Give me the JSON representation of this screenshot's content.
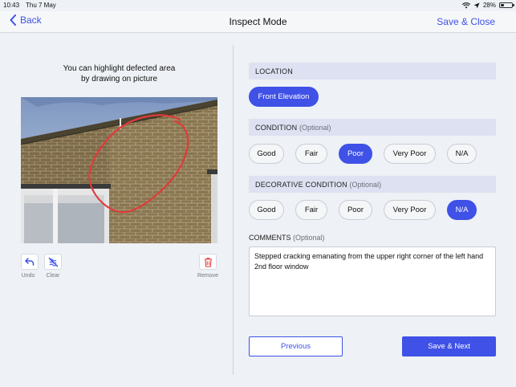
{
  "status_bar": {
    "time": "10:43",
    "date": "Thu 7 May",
    "battery": "28%",
    "battery_level": 0.28
  },
  "nav": {
    "back_label": "Back",
    "title": "Inspect Mode",
    "save_close_label": "Save & Close"
  },
  "editor": {
    "hint_line1": "You can highlight defected area",
    "hint_line2": "by drawing on picture",
    "undo_label": "Undo",
    "clear_label": "Clear",
    "remove_label": "Remove"
  },
  "location": {
    "heading": "LOCATION",
    "options": [
      "Front Elevation"
    ],
    "selected": "Front Elevation"
  },
  "condition": {
    "heading": "CONDITION",
    "optional": "(Optional)",
    "options": [
      "Good",
      "Fair",
      "Poor",
      "Very Poor",
      "N/A"
    ],
    "selected": "Poor"
  },
  "decorative_condition": {
    "heading": "DECORATIVE CONDITION",
    "optional": "(Optional)",
    "options": [
      "Good",
      "Fair",
      "Poor",
      "Very Poor",
      "N/A"
    ],
    "selected": "N/A"
  },
  "comments": {
    "label": "COMMENTS",
    "optional": "(Optional)",
    "value": "Stepped cracking emanating from the upper right corner of the left hand 2nd floor window"
  },
  "actions": {
    "previous_label": "Previous",
    "next_label": "Save & Next"
  },
  "colors": {
    "accent": "#3f51e6",
    "section_bg": "#dde1f2",
    "page_bg": "#eef1f5",
    "highlight_stroke": "#e03a3a"
  },
  "icons": {
    "back": "chevron-left-icon",
    "undo": "undo-icon",
    "clear": "clear-drawing-icon",
    "remove": "trash-icon",
    "wifi": "wifi-icon",
    "location": "location-arrow-icon",
    "battery": "battery-icon"
  }
}
